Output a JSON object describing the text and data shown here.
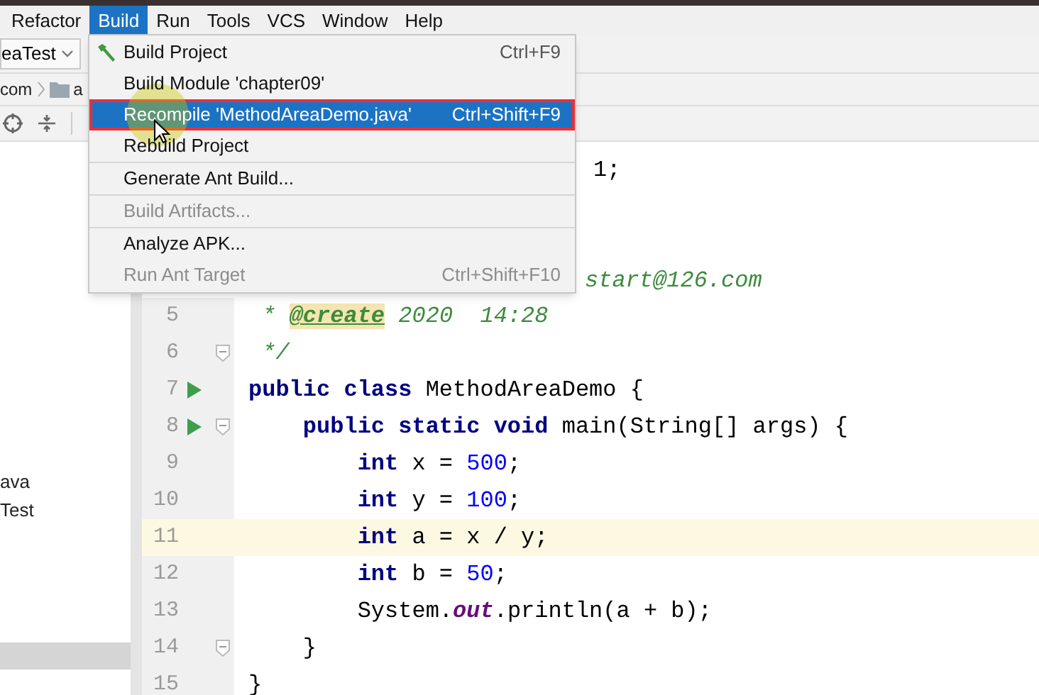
{
  "menubar": [
    {
      "label": "Refactor",
      "selected": false
    },
    {
      "label": "Build",
      "selected": true
    },
    {
      "label": "Run",
      "selected": false
    },
    {
      "label": "Tools",
      "selected": false
    },
    {
      "label": "VCS",
      "selected": false
    },
    {
      "label": "Window",
      "selected": false
    },
    {
      "label": "Help",
      "selected": false
    }
  ],
  "run_config": {
    "label": "eaTest"
  },
  "breadcrumb": [
    {
      "label": "com",
      "kind": "package"
    },
    {
      "label": "a",
      "kind": "folder"
    }
  ],
  "project_tree": [
    {
      "label": "ava",
      "selected": false
    },
    {
      "label": "Test",
      "selected": false
    },
    {
      "selected": true
    }
  ],
  "build_menu": [
    {
      "kind": "item",
      "label": "Build Project",
      "shortcut": "Ctrl+F9",
      "disabled": false,
      "selected": false
    },
    {
      "kind": "item",
      "label": "Build Module 'chapter09'",
      "disabled": false,
      "selected": false
    },
    {
      "kind": "item",
      "label": "Recompile 'MethodAreaDemo.java'",
      "shortcut": "Ctrl+Shift+F9",
      "disabled": false,
      "selected": true
    },
    {
      "kind": "item",
      "label": "Rebuild Project",
      "disabled": false,
      "selected": false
    },
    {
      "kind": "separator"
    },
    {
      "kind": "item",
      "label": "Generate Ant Build...",
      "disabled": false,
      "selected": false
    },
    {
      "kind": "separator"
    },
    {
      "kind": "item",
      "label": "Build Artifacts...",
      "disabled": true,
      "selected": false
    },
    {
      "kind": "separator"
    },
    {
      "kind": "item",
      "label": "Analyze APK...",
      "disabled": false,
      "selected": false
    },
    {
      "kind": "item",
      "label": "Run Ant Target",
      "shortcut": "Ctrl+Shift+F10",
      "disabled": true,
      "selected": false
    }
  ],
  "editor": {
    "partial_texts": [
      {
        "kind": "plain",
        "text": "1;"
      },
      {
        "kind": "comment",
        "text": "start@126.com"
      }
    ],
    "lines": [
      {
        "number": "5",
        "tokens": [
          {
            "kind": "comment",
            "text": " * "
          },
          {
            "kind": "tag",
            "text": "@create"
          },
          {
            "kind": "comment",
            "text": " 2020  14:28"
          }
        ],
        "current": false,
        "run": false,
        "fold": false
      },
      {
        "number": "6",
        "tokens": [
          {
            "kind": "comment",
            "text": " */"
          }
        ],
        "current": false,
        "run": false,
        "fold": true
      },
      {
        "number": "7",
        "tokens": [
          {
            "kind": "keyword",
            "text": "public class "
          },
          {
            "kind": "plain",
            "text": "MethodAreaDemo {"
          }
        ],
        "current": false,
        "run": true,
        "fold": false
      },
      {
        "number": "8",
        "tokens": [
          {
            "kind": "keyword",
            "text": "    public static void "
          },
          {
            "kind": "plain",
            "text": "main(String[] args) {"
          }
        ],
        "current": false,
        "run": true,
        "fold": true
      },
      {
        "number": "9",
        "tokens": [
          {
            "kind": "keyword",
            "text": "        int "
          },
          {
            "kind": "plain",
            "text": "x = "
          },
          {
            "kind": "number",
            "text": "500"
          },
          {
            "kind": "plain",
            "text": ";"
          }
        ],
        "current": false,
        "run": false,
        "fold": false
      },
      {
        "number": "10",
        "tokens": [
          {
            "kind": "keyword",
            "text": "        int "
          },
          {
            "kind": "plain",
            "text": "y = "
          },
          {
            "kind": "number",
            "text": "100"
          },
          {
            "kind": "plain",
            "text": ";"
          }
        ],
        "current": false,
        "run": false,
        "fold": false
      },
      {
        "number": "11",
        "tokens": [
          {
            "kind": "keyword",
            "text": "        int "
          },
          {
            "kind": "plain",
            "text": "a = x / y;"
          }
        ],
        "current": true,
        "run": false,
        "fold": false
      },
      {
        "number": "12",
        "tokens": [
          {
            "kind": "keyword",
            "text": "        int "
          },
          {
            "kind": "plain",
            "text": "b = "
          },
          {
            "kind": "number",
            "text": "50"
          },
          {
            "kind": "plain",
            "text": ";"
          }
        ],
        "current": false,
        "run": false,
        "fold": false
      },
      {
        "number": "13",
        "tokens": [
          {
            "kind": "plain",
            "text": "        System."
          },
          {
            "kind": "field",
            "text": "out"
          },
          {
            "kind": "plain",
            "text": ".println(a + b);"
          }
        ],
        "current": false,
        "run": false,
        "fold": false
      },
      {
        "number": "14",
        "tokens": [
          {
            "kind": "plain",
            "text": "    }"
          }
        ],
        "current": false,
        "run": false,
        "fold": true
      },
      {
        "number": "15",
        "tokens": [
          {
            "kind": "plain",
            "text": "}"
          }
        ],
        "current": false,
        "run": false,
        "fold": false
      }
    ]
  }
}
